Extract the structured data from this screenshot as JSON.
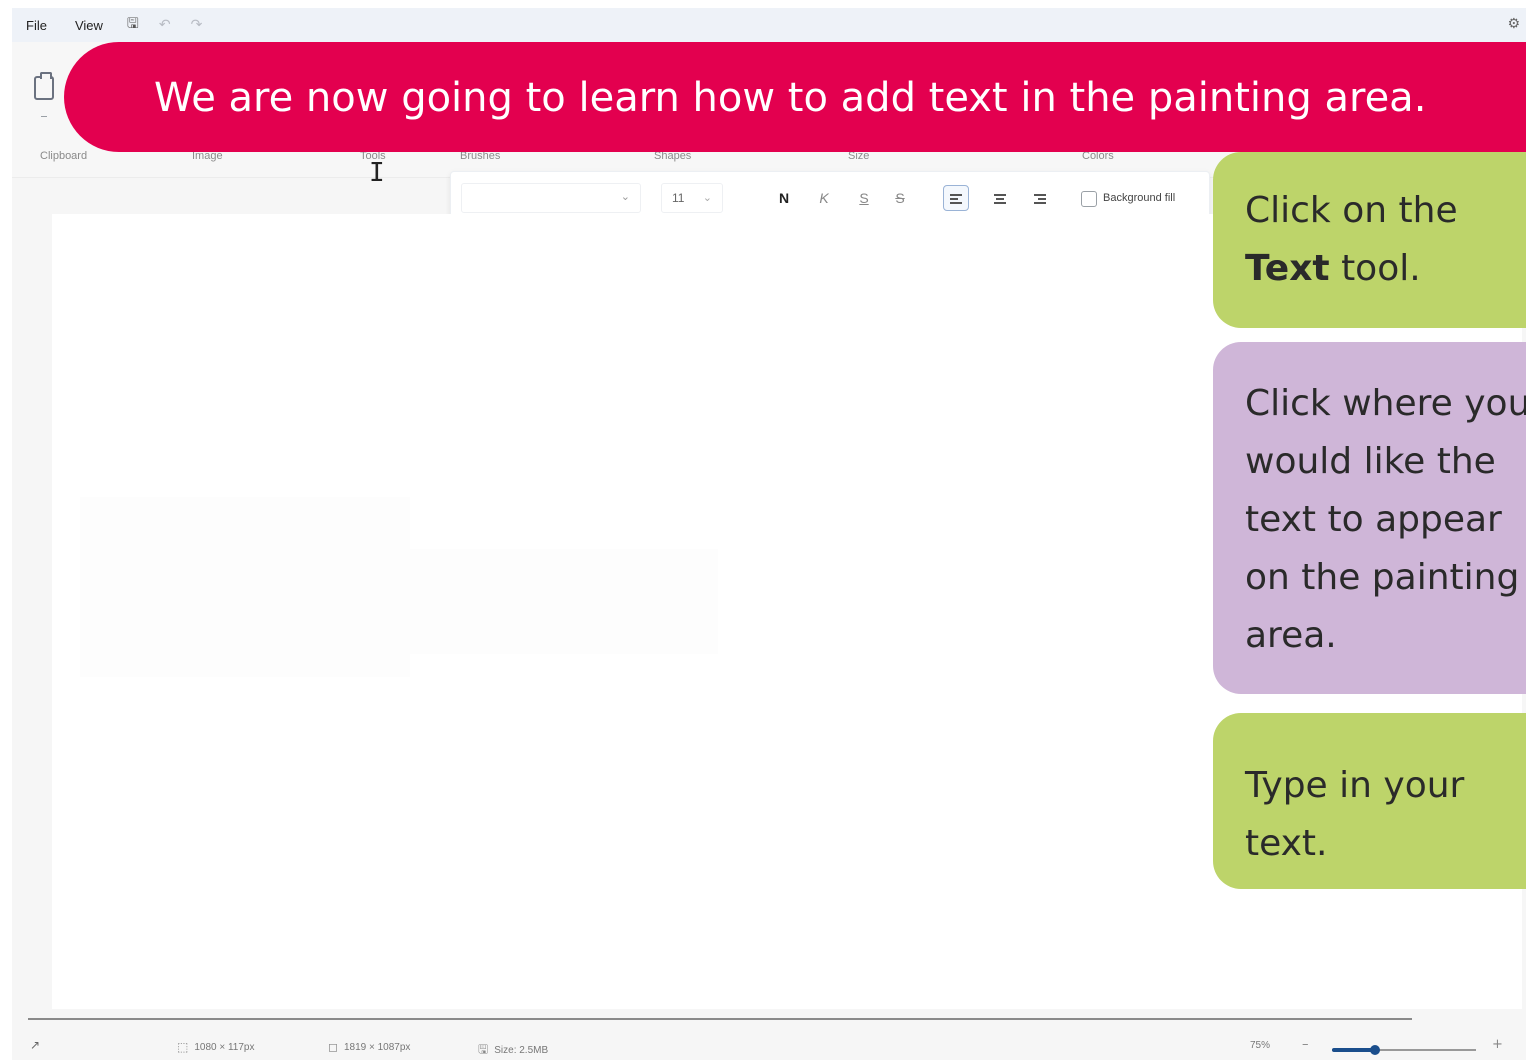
{
  "menubar": {
    "file_label": "File",
    "view_label": "View",
    "icons": [
      "save-icon",
      "undo-icon",
      "redo-icon",
      "settings-icon"
    ]
  },
  "ribbon": {
    "groups": [
      "Clipboard",
      "Image",
      "Tools",
      "Brushes",
      "Shapes",
      "Size",
      "Colors"
    ]
  },
  "text_toolbar": {
    "font_value": "",
    "size_value": "11",
    "bold_label": "N",
    "italic_label": "K",
    "underline_label": "S",
    "strike_label": "S",
    "background_fill_label": "Background fill",
    "background_fill_checked": false
  },
  "statusbar": {
    "selection": "1080 × 117px",
    "canvas_size": "1819 × 1087px",
    "file_size": "Size: 2.5MB",
    "zoom": "75%",
    "zoom_fraction": 0.3
  },
  "banner": {
    "text": "We are now going to learn how to add text in the painting area.",
    "color": "#e3004f"
  },
  "callouts": {
    "step1_prefix": "Click on the",
    "step1_bold": "Text",
    "step1_suffix": " tool.",
    "step2_lines": [
      "Click where you",
      "would like the",
      "text to appear",
      "on the painting",
      "area."
    ],
    "step3_lines": [
      "Type in your",
      "text."
    ],
    "green": "#bdd46a",
    "purple": "#cfb6d8"
  }
}
